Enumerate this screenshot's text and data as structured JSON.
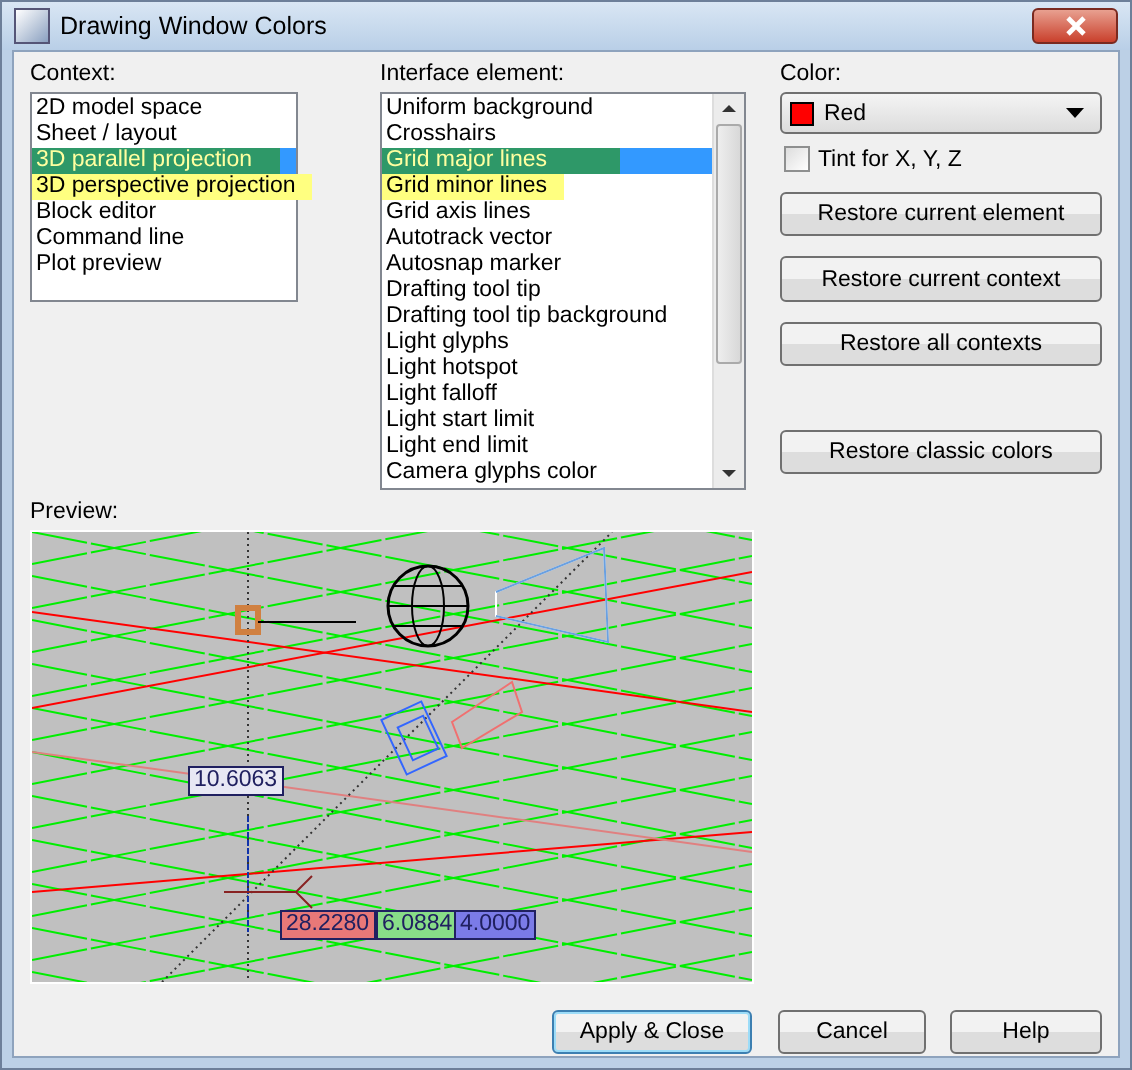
{
  "window": {
    "title": "Drawing Window Colors"
  },
  "context": {
    "label": "Context:",
    "items": [
      {
        "label": "2D model space",
        "selected": false,
        "highlighted": false
      },
      {
        "label": "Sheet / layout",
        "selected": false,
        "highlighted": false
      },
      {
        "label": "3D parallel projection",
        "selected": true,
        "highlighted": true
      },
      {
        "label": "3D perspective projection",
        "selected": false,
        "highlighted": true
      },
      {
        "label": "Block editor",
        "selected": false,
        "highlighted": false
      },
      {
        "label": "Command line",
        "selected": false,
        "highlighted": false
      },
      {
        "label": "Plot preview",
        "selected": false,
        "highlighted": false
      }
    ]
  },
  "interface_element": {
    "label": "Interface element:",
    "items": [
      {
        "label": "Uniform background",
        "selected": false,
        "highlighted": false
      },
      {
        "label": "Crosshairs",
        "selected": false,
        "highlighted": false
      },
      {
        "label": "Grid major lines",
        "selected": true,
        "highlighted": true
      },
      {
        "label": "Grid minor lines",
        "selected": false,
        "highlighted": true
      },
      {
        "label": "Grid axis lines",
        "selected": false,
        "highlighted": false
      },
      {
        "label": "Autotrack vector",
        "selected": false,
        "highlighted": false
      },
      {
        "label": "Autosnap marker",
        "selected": false,
        "highlighted": false
      },
      {
        "label": "Drafting tool tip",
        "selected": false,
        "highlighted": false
      },
      {
        "label": "Drafting tool tip background",
        "selected": false,
        "highlighted": false
      },
      {
        "label": "Light glyphs",
        "selected": false,
        "highlighted": false
      },
      {
        "label": "Light hotspot",
        "selected": false,
        "highlighted": false
      },
      {
        "label": "Light falloff",
        "selected": false,
        "highlighted": false
      },
      {
        "label": "Light start limit",
        "selected": false,
        "highlighted": false
      },
      {
        "label": "Light end limit",
        "selected": false,
        "highlighted": false
      },
      {
        "label": "Camera glyphs color",
        "selected": false,
        "highlighted": false
      }
    ]
  },
  "color": {
    "label": "Color:",
    "value": "Red",
    "color": "#ff0000"
  },
  "tint": {
    "label": "Tint for X, Y, Z",
    "checked": false
  },
  "restore_buttons": [
    "Restore current element",
    "Restore current context",
    "Restore all contexts",
    "Restore classic colors"
  ],
  "preview": {
    "label": "Preview:",
    "tooltips": [
      {
        "text": "10.6063",
        "color": "#e8e8f4"
      },
      {
        "text": "28.2280",
        "color": "#e87878"
      },
      {
        "text": "6.0884",
        "color": "#88dd88"
      },
      {
        "text": "4.0000",
        "color": "#7b7be8"
      }
    ]
  },
  "buttons": [
    {
      "label": "Apply & Close",
      "default": true
    },
    {
      "label": "Cancel",
      "default": false
    },
    {
      "label": "Help",
      "default": false
    }
  ]
}
